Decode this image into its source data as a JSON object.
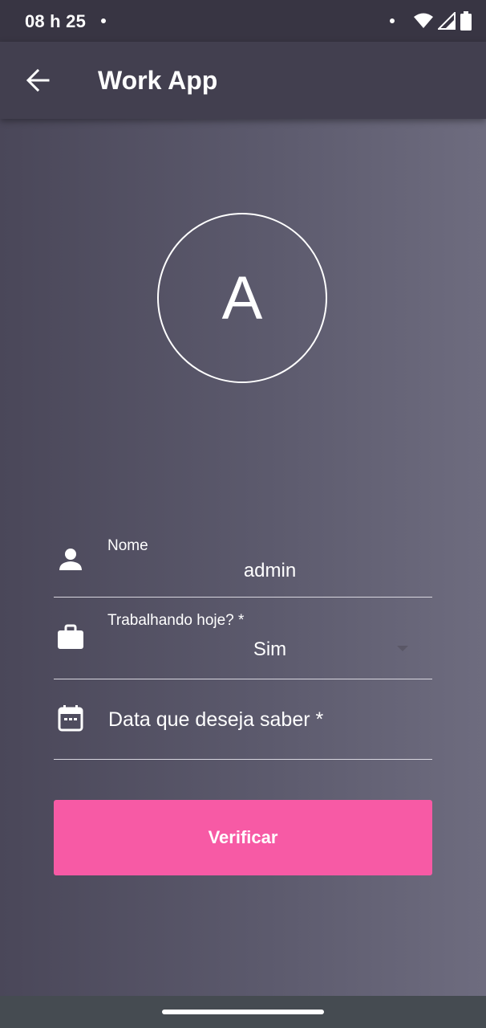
{
  "status_bar": {
    "time": "08 h 25",
    "icons": [
      "notification-dot-icon",
      "wifi-icon",
      "signal-icon",
      "battery-icon"
    ]
  },
  "app_bar": {
    "back_icon": "arrow-left-icon",
    "title": "Work App"
  },
  "avatar": {
    "letter": "A"
  },
  "form": {
    "name_field": {
      "icon": "person-icon",
      "label": "Nome",
      "value": "admin"
    },
    "working_field": {
      "icon": "briefcase-icon",
      "label": "Trabalhando hoje? *",
      "selected": "Sim"
    },
    "date_field": {
      "icon": "calendar-icon",
      "placeholder": "Data que deseja saber *"
    },
    "submit_label": "Verificar"
  },
  "colors": {
    "status_bar": "#383543",
    "app_bar": "#423f4f",
    "background_start": "#4a4759",
    "background_end": "#6e6c7f",
    "accent_button": "#f75aa5",
    "nav_bar": "#454b51"
  }
}
